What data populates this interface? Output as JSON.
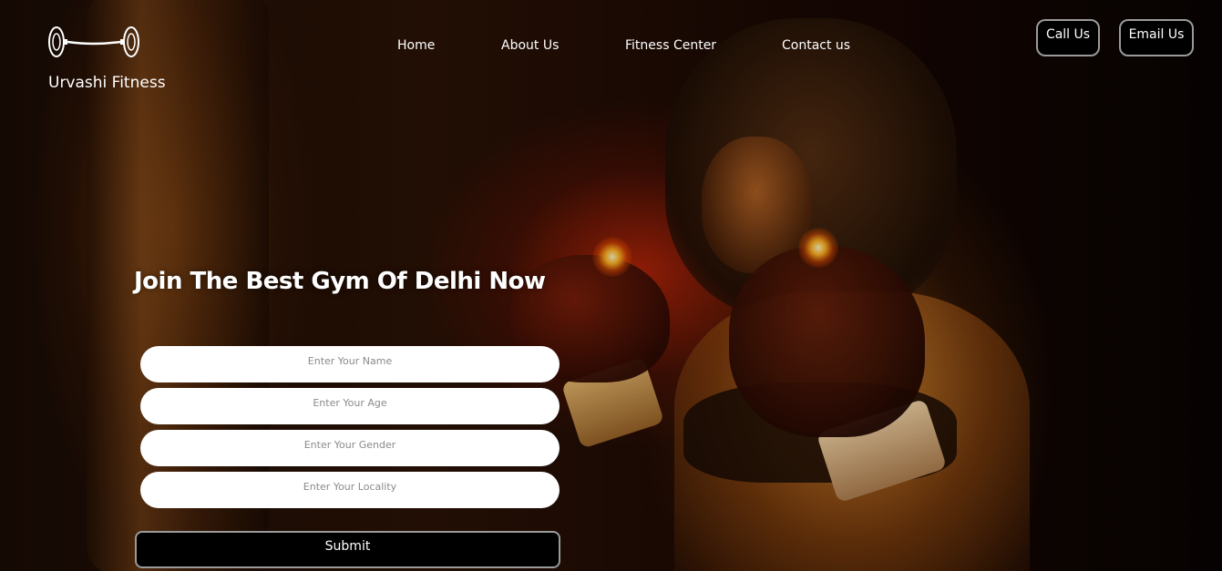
{
  "brand": {
    "name": "Urvashi Fitness",
    "logo_icon": "dumbbell-icon"
  },
  "nav": {
    "items": [
      {
        "label": "Home"
      },
      {
        "label": "About Us"
      },
      {
        "label": "Fitness Center"
      },
      {
        "label": "Contact us"
      }
    ]
  },
  "header_buttons": {
    "call": "Call Us",
    "email": "Email Us"
  },
  "hero": {
    "headline": "Join The Best Gym Of Delhi Now"
  },
  "form": {
    "name_placeholder": "Enter Your Name",
    "age_placeholder": "Enter Your Age",
    "gender_placeholder": "Enter Your Gender",
    "locality_placeholder": "Enter Your Locality",
    "submit_label": "Submit"
  },
  "colors": {
    "page_background": "#000000",
    "text": "#ffffff",
    "button_border": "#9a9a9a",
    "input_background": "#ffffff"
  }
}
